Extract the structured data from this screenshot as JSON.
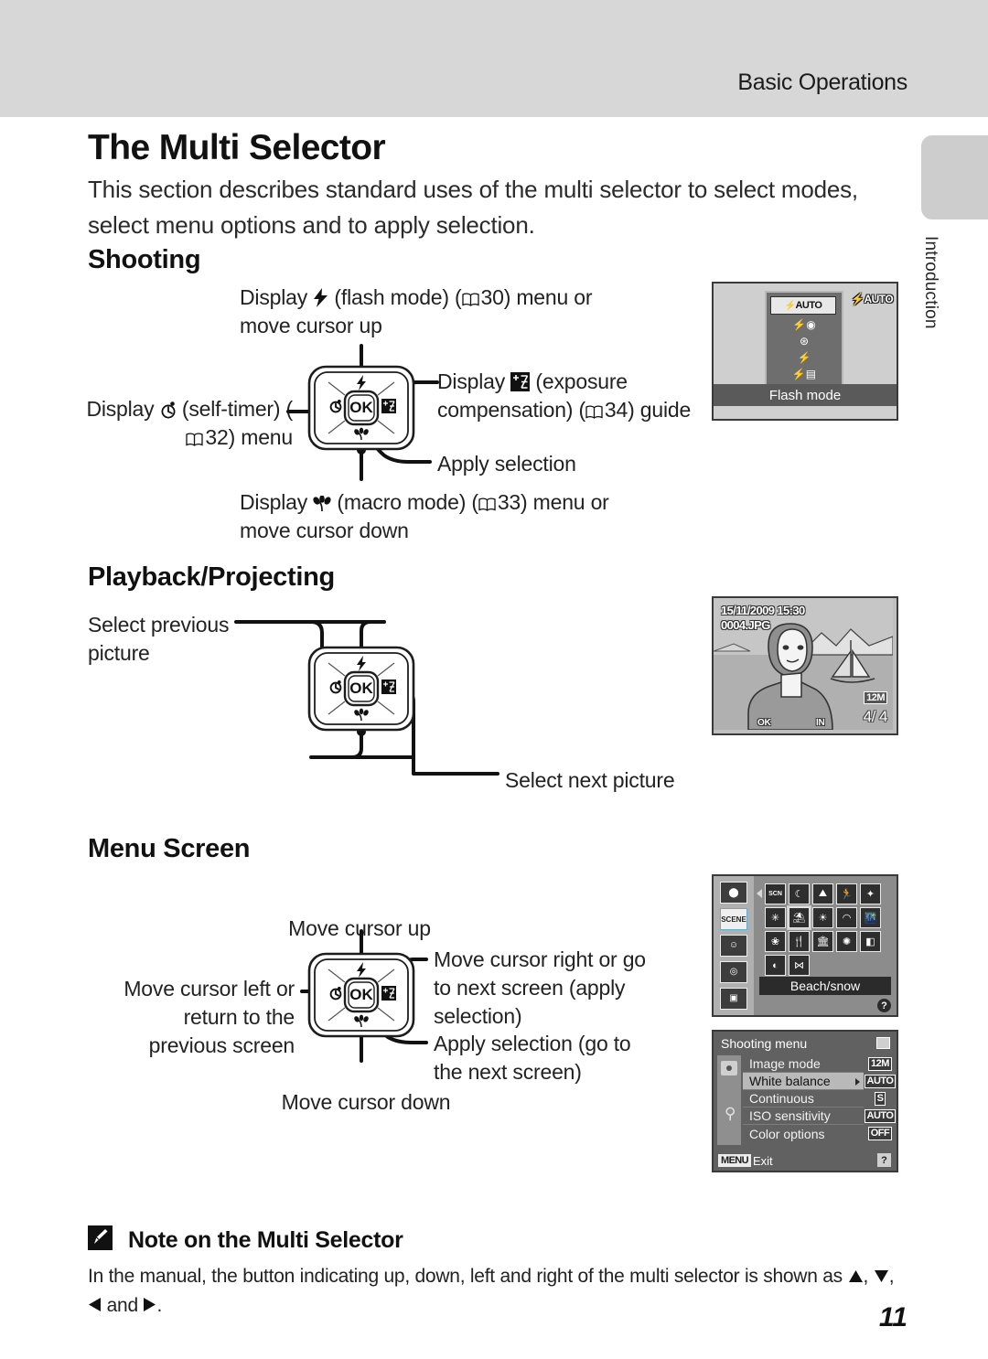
{
  "header": {
    "section_title": "Basic Operations"
  },
  "side_tab": {
    "label": "Introduction"
  },
  "page": {
    "number": "11"
  },
  "title": "The Multi Selector",
  "intro": "This section describes standard uses of the multi selector to select modes, select menu options and to apply selection.",
  "sections": {
    "shooting": {
      "heading": "Shooting",
      "captions": {
        "up_pre": "Display",
        "up_mid": "(flash mode) (",
        "up_page": "30",
        "up_post": ") menu or move cursor up",
        "left_pre": "Display",
        "left_mid": "(self-timer) (",
        "left_page": "32",
        "left_post": ") menu",
        "right_pre": "Display",
        "right_mid": "(exposure compensation) (",
        "right_page": "34",
        "right_post": ") guide",
        "center": "Apply selection",
        "down_pre": "Display",
        "down_mid": "(macro mode) (",
        "down_page": "33",
        "down_post": ") menu or move cursor down"
      },
      "lcd": {
        "selected_mode": "AUTO",
        "caption": "Flash mode",
        "badge": "AUTO",
        "options": [
          "flash-auto",
          "red-eye-reduction",
          "flash-off",
          "fill-flash",
          "slow-sync"
        ]
      }
    },
    "playback": {
      "heading": "Playback/Projecting",
      "captions": {
        "left": "Select previous picture",
        "right": "Select next picture"
      },
      "lcd": {
        "date": "15/11/2009 15:30",
        "filename": "0004.JPG",
        "counter": "4/ 4",
        "image_mode": "12M",
        "ok_hint": "OK",
        "memory": "IN"
      }
    },
    "menu": {
      "heading": "Menu Screen",
      "captions": {
        "up": "Move cursor up",
        "left": "Move cursor left or return to the previous screen",
        "right": "Move cursor right or go to next screen (apply selection)",
        "center": "Apply selection (go to the next screen)",
        "down": "Move cursor down"
      },
      "scene_lcd": {
        "selected_label": "Beach/snow",
        "left_tabs": [
          "shooting-mode-tab",
          "scene-mode-tab",
          "smart-portrait-tab",
          "subject-tracking-tab",
          "movie-tab"
        ],
        "selected_tab_index": 1,
        "help_badge": "?",
        "icons": [
          "scene-auto",
          "night-landscape",
          "landscape",
          "sports",
          "portrait-frame",
          "party",
          "beach-snow",
          "sunset",
          "dusk-dawn",
          "night-portrait",
          "close-up",
          "food",
          "museum",
          "fireworks",
          "copy",
          "backlight",
          "panorama"
        ],
        "highlighted_icon_index": 6
      },
      "shooting_menu_lcd": {
        "title": "Shooting menu",
        "items": [
          {
            "label": "Image mode",
            "value": "12M",
            "selected": false
          },
          {
            "label": "White balance",
            "value": "AUTO",
            "selected": true
          },
          {
            "label": "Continuous",
            "value": "S",
            "selected": false
          },
          {
            "label": "ISO sensitivity",
            "value": "AUTO",
            "selected": false
          },
          {
            "label": "Color options",
            "value": "OFF",
            "selected": false
          }
        ],
        "footer_badge": "MENU",
        "footer_label": "Exit",
        "help_badge": "?"
      }
    }
  },
  "note": {
    "icon": "pencil-icon",
    "title": "Note on the Multi Selector",
    "body_1": "In the manual, the button indicating up, down, left and right of the multi selector is shown as",
    "body_2": ",",
    "body_3": "and",
    "body_4": "."
  },
  "colors": {
    "header_band": "#d7d7d7",
    "side_tab": "#cdcdcd",
    "text": "#1a1a1a",
    "lcd_dark": "#616161"
  }
}
